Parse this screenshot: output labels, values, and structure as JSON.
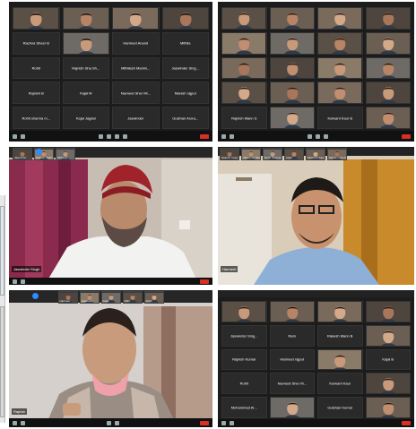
{
  "panel1": {
    "tiles": [
      {
        "name": "",
        "sub": "",
        "photo": true
      },
      {
        "name": "",
        "sub": "",
        "photo": true
      },
      {
        "name": "",
        "sub": "",
        "photo": true
      },
      {
        "name": "",
        "sub": "",
        "photo": true
      },
      {
        "name": "Rachna Sheer B",
        "sub": "",
        "photo": false
      },
      {
        "name": "",
        "sub": "",
        "photo": true
      },
      {
        "name": "Harmeet Anand",
        "sub": "",
        "photo": false
      },
      {
        "name": "Mithila",
        "sub": "",
        "photo": false
      },
      {
        "name": "Rohit",
        "sub": "",
        "photo": false
      },
      {
        "name": "Rajnish Sha Sh...",
        "sub": "",
        "photo": false
      },
      {
        "name": "Mithilesh Mamin...",
        "sub": "",
        "photo": false
      },
      {
        "name": "Jaswinder Sing...",
        "sub": "",
        "photo": false
      },
      {
        "name": "Rajnish B",
        "sub": "",
        "photo": false
      },
      {
        "name": "Kajal M",
        "sub": "",
        "photo": false
      },
      {
        "name": "Navneet Sher Mi...",
        "sub": "",
        "photo": false
      },
      {
        "name": "Manish rajput",
        "sub": "",
        "photo": false
      },
      {
        "name": "Rohit sharma m...",
        "sub": "",
        "photo": false
      },
      {
        "name": "Kajal Jagdal",
        "sub": "",
        "photo": false
      },
      {
        "name": "Jaswinder",
        "sub": "",
        "photo": false
      },
      {
        "name": "Gulshan Arora...",
        "sub": "",
        "photo": false
      }
    ]
  },
  "panel2": {
    "tiles": [
      {
        "name": "",
        "photo": true
      },
      {
        "name": "",
        "photo": true
      },
      {
        "name": "",
        "photo": true
      },
      {
        "name": "",
        "photo": true
      },
      {
        "name": "",
        "photo": true
      },
      {
        "name": "",
        "photo": true
      },
      {
        "name": "",
        "photo": true
      },
      {
        "name": "",
        "photo": true
      },
      {
        "name": "",
        "photo": true
      },
      {
        "name": "",
        "photo": true
      },
      {
        "name": "",
        "photo": true
      },
      {
        "name": "",
        "photo": true
      },
      {
        "name": "",
        "photo": true
      },
      {
        "name": "",
        "photo": true
      },
      {
        "name": "",
        "photo": true
      },
      {
        "name": "",
        "photo": true
      },
      {
        "name": "Rajnish Mann S",
        "photo": false
      },
      {
        "name": "",
        "photo": true
      },
      {
        "name": "Kulwant Kaur B",
        "photo": false
      },
      {
        "name": "",
        "photo": true
      }
    ]
  },
  "panel3": {
    "speaker": "Jaswinder Singh",
    "top_labels": [
      "Jaswinder",
      "Rakesh Sharm...",
      "Mithilesh"
    ]
  },
  "panel4": {
    "speaker": "Harmeet",
    "top_labels": [
      "Rakesh Arora",
      "Jaswinder Sing",
      "Rohit Sharma",
      "Kajal",
      "Mithilesh Kaur",
      "Mohammad Ar..."
    ]
  },
  "panel5": {
    "speaker": "Rajnish",
    "top_labels": [
      "Harmeet",
      "Jaswinder",
      "Kajal",
      "Mithi",
      "Rohit"
    ]
  },
  "panel6": {
    "tiles": [
      {
        "name": "",
        "photo": true
      },
      {
        "name": "",
        "photo": true
      },
      {
        "name": "",
        "photo": true
      },
      {
        "name": "",
        "photo": true
      },
      {
        "name": "Jaswinder Sing...",
        "photo": false
      },
      {
        "name": "Ram",
        "photo": false
      },
      {
        "name": "Rakesh Mann B",
        "photo": false
      },
      {
        "name": "",
        "photo": true
      },
      {
        "name": "Rajnish Kumar",
        "photo": false
      },
      {
        "name": "Harmeet rajput",
        "photo": false
      },
      {
        "name": "",
        "photo": true
      },
      {
        "name": "Kajal B",
        "photo": false
      },
      {
        "name": "Rohit",
        "photo": false
      },
      {
        "name": "Navneet Sher M...",
        "photo": false
      },
      {
        "name": "Kulwant Kaur",
        "photo": false
      },
      {
        "name": "",
        "photo": true
      },
      {
        "name": "Mohammad Ar...",
        "photo": false
      },
      {
        "name": "",
        "photo": true
      },
      {
        "name": "Gulshan Kumar",
        "photo": false
      },
      {
        "name": "",
        "photo": true
      }
    ]
  },
  "colors": {
    "toolbar": "#111111",
    "end": "#d93025",
    "zoom_blue": "#2d8cff"
  }
}
